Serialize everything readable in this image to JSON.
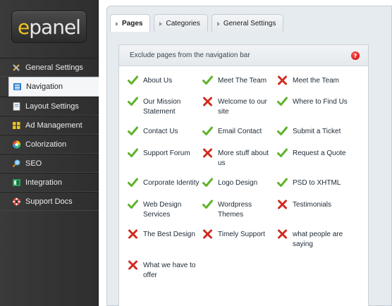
{
  "logo": {
    "e": "e",
    "rest": "panel"
  },
  "nav": [
    {
      "label": "General Settings",
      "icon": "wrench-icon",
      "active": false
    },
    {
      "label": "Navigation",
      "icon": "list-icon",
      "active": true
    },
    {
      "label": "Layout Settings",
      "icon": "page-icon",
      "active": false
    },
    {
      "label": "Ad Management",
      "icon": "grid-icon",
      "active": false
    },
    {
      "label": "Colorization",
      "icon": "color-wheel-icon",
      "active": false
    },
    {
      "label": "SEO",
      "icon": "magnifier-icon",
      "active": false
    },
    {
      "label": "Integration",
      "icon": "plug-icon",
      "active": false
    },
    {
      "label": "Support Docs",
      "icon": "lifebuoy-icon",
      "active": false
    }
  ],
  "tabs": [
    {
      "label": "Pages",
      "active": true
    },
    {
      "label": "Categories",
      "active": false
    },
    {
      "label": "General Settings",
      "active": false
    }
  ],
  "section": {
    "title": "Exclude pages from the navigation bar",
    "help": "?"
  },
  "pages": [
    [
      {
        "label": "About Us",
        "included": true
      },
      {
        "label": "Meet The Team",
        "included": true
      },
      {
        "label": "Meet the Team",
        "included": false
      }
    ],
    [
      {
        "label": "Our Mission Statement",
        "included": true
      },
      {
        "label": "Welcome to our site",
        "included": false
      },
      {
        "label": "Where to Find Us",
        "included": true
      }
    ],
    [
      {
        "label": "Contact Us",
        "included": true
      },
      {
        "label": "Email Contact",
        "included": true
      },
      {
        "label": "Submit a Ticket",
        "included": true
      }
    ],
    [
      {
        "label": "Support Forum",
        "included": true
      },
      {
        "label": "More stuff about us",
        "included": false
      },
      {
        "label": "Request a Quote",
        "included": true
      }
    ],
    [
      {
        "label": "Corporate Identity",
        "included": true
      },
      {
        "label": "Logo Design",
        "included": true
      },
      {
        "label": "PSD to XHTML",
        "included": true
      }
    ],
    [
      {
        "label": "Web Design Services",
        "included": true
      },
      {
        "label": "Wordpress Themes",
        "included": true
      },
      {
        "label": "Testimonials",
        "included": false
      }
    ],
    [
      {
        "label": "The Best Design",
        "included": false
      },
      {
        "label": "Timely Support",
        "included": false
      },
      {
        "label": "what people are saying",
        "included": false
      }
    ],
    [
      {
        "label": "What we have to offer",
        "included": false
      }
    ]
  ],
  "colors": {
    "check": "#5fb32a",
    "cross": "#d12a1f",
    "accent": "#f0c419"
  }
}
